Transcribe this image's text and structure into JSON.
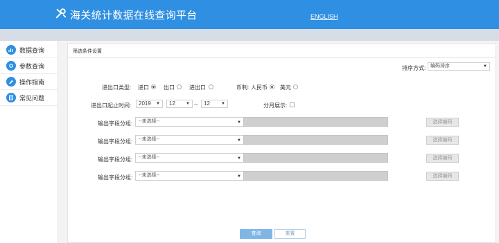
{
  "header": {
    "title": "海关统计数据在线查询平台",
    "lang_link": "ENGLISH",
    "logo_icon": "tools-icon",
    "color": "#2f8fe2"
  },
  "sidebar": {
    "items": [
      {
        "label": "数据查询",
        "icon": "data-icon"
      },
      {
        "label": "参数查询",
        "icon": "param-icon"
      },
      {
        "label": "操作指南",
        "icon": "guide-icon"
      },
      {
        "label": "常见问题",
        "icon": "faq-icon"
      }
    ]
  },
  "panel": {
    "title": "筛选条件设置",
    "sort": {
      "label": "排序方式:",
      "value": "编码排序"
    },
    "trade_type": {
      "label": "进出口类型:",
      "options": [
        {
          "label": "进口",
          "selected": true
        },
        {
          "label": "出口",
          "selected": false
        },
        {
          "label": "进出口",
          "selected": false
        }
      ]
    },
    "currency": {
      "label": "币制:",
      "options": [
        {
          "label": "人民币",
          "selected": true
        },
        {
          "label": "美元",
          "selected": false
        }
      ]
    },
    "period": {
      "label": "进出口起止时间:",
      "year": "2019",
      "month_start": "12",
      "separator": "--",
      "month_end": "12"
    },
    "monthly": {
      "label": "分月展示:",
      "checked": false
    },
    "field_groups": [
      {
        "label": "输出字段分组:",
        "placeholder": "--未选择--",
        "button": "选择编码"
      },
      {
        "label": "输出字段分组:",
        "placeholder": "--未选择--",
        "button": "选择编码"
      },
      {
        "label": "输出字段分组:",
        "placeholder": "--未选择--",
        "button": "选择编码"
      },
      {
        "label": "输出字段分组:",
        "placeholder": "--未选择--",
        "button": "选择编码"
      }
    ],
    "buttons": {
      "query": "查询",
      "reset": "重置"
    }
  }
}
